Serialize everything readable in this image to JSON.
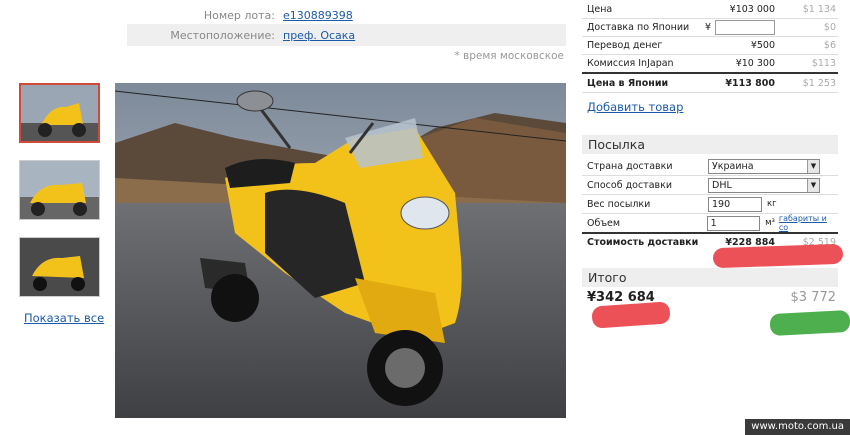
{
  "lot": {
    "number_label": "Номер лота:",
    "number_value": "e130889398",
    "location_label": "Местоположение:",
    "location_value": "преф. Осака",
    "time_note": "* время московское"
  },
  "gallery": {
    "show_all": "Показать все"
  },
  "prices": {
    "rows": [
      {
        "label": "Цена",
        "jpy": "¥103 000",
        "usd": "$1 134"
      },
      {
        "label": "Доставка по Японии",
        "jpy": "¥",
        "usd": "$0"
      },
      {
        "label": "Перевод денег",
        "jpy": "¥500",
        "usd": "$6"
      },
      {
        "label": "Комиссия InJapan",
        "jpy": "¥10 300",
        "usd": "$113"
      }
    ],
    "total_japan": {
      "label": "Цена в Японии",
      "jpy": "¥113 800",
      "usd": "$1 253"
    },
    "add_item": "Добавить товар"
  },
  "shipping": {
    "title": "Посылка",
    "country_label": "Страна доставки",
    "country_value": "Украина",
    "method_label": "Способ доставки",
    "method_value": "DHL",
    "weight_label": "Вес посылки",
    "weight_value": "190",
    "weight_unit": "кг",
    "volume_label": "Объем",
    "volume_value": "1",
    "volume_unit": "м³",
    "dims_link": "габариты и со",
    "cost_label": "Стоимость доставки",
    "cost_jpy": "¥228 884",
    "cost_usd": "$2 519"
  },
  "summary": {
    "title": "Итого",
    "total_jpy": "¥342 684",
    "total_usd": "$3 772"
  },
  "watermark": "www.moto.com.ua",
  "colors": {
    "link": "#1b5aa8",
    "scooter": "#f2c21a",
    "red_mark": "#e8323a",
    "green_mark": "#3aa63a"
  }
}
